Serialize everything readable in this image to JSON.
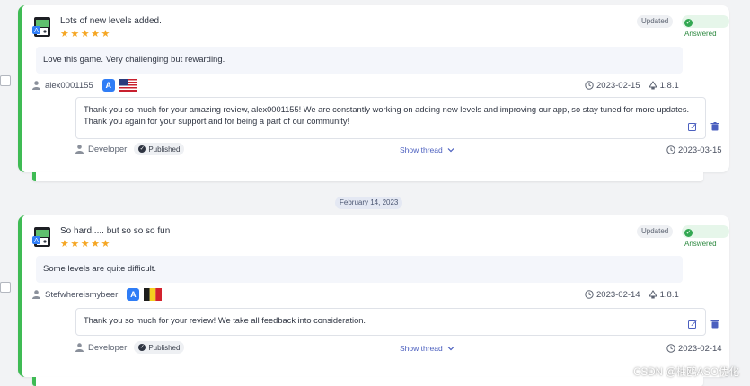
{
  "reviews": [
    {
      "title": "Lots of new levels added.",
      "stars": "★★★★★",
      "rating": 5,
      "status_updated": "Updated",
      "status_answered": "Answered",
      "body": "Love this game. Very challenging but rewarding.",
      "author": "alex0001155",
      "store_icon": "app-store-icon",
      "flag": "us-flag",
      "date": "2023-02-15",
      "version": "1.8.1",
      "reply": {
        "text": "Thank you so much for your amazing review, alex0001155! We are constantly working on adding new levels and improving our app, so stay tuned for more updates. Thank you again for your support and for being a part of our community!",
        "author": "Developer",
        "status": "Published",
        "thread_link": "Show thread",
        "date": "2023-03-15"
      }
    },
    {
      "title": "So hard..... but so so so fun",
      "stars": "★★★★★",
      "rating": 5,
      "status_updated": "Updated",
      "status_answered": "Answered",
      "body": "Some levels are quite difficult.",
      "author": "Stefwhereismybeer",
      "store_icon": "app-store-icon",
      "flag": "belgium-flag",
      "date": "2023-02-14",
      "version": "1.8.1",
      "reply": {
        "text": "Thank you so much for your review! We take all feedback into consideration.",
        "author": "Developer",
        "status": "Published",
        "thread_link": "Show thread",
        "date": "2023-02-14"
      }
    }
  ],
  "date_separator": "February 14, 2023",
  "watermark": "CSDN @柚鸥ASO优化",
  "colors": {
    "accent_green": "#3fbb54",
    "star": "#f5a623",
    "link": "#4b5fbf",
    "store_blue": "#2f7df6"
  }
}
